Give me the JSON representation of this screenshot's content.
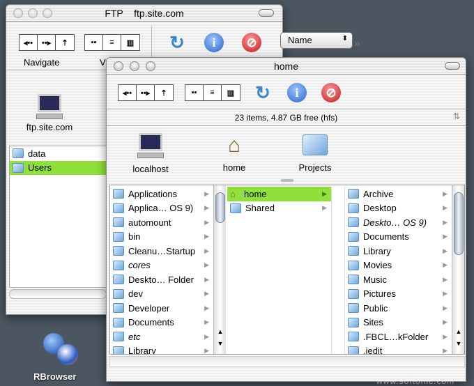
{
  "back_window": {
    "title": "FTP    ftp.site.com",
    "toolbar": {
      "navigate_label": "Navigate",
      "view_label": "V",
      "sort_popup": "Name",
      "overflow": "»",
      "nav": [
        "◂••",
        "••▸",
        "⇡"
      ],
      "view": [
        "▪▪",
        "≡",
        "▥"
      ]
    },
    "shelf": {
      "item": "ftp.site.com"
    },
    "list": [
      {
        "name": "data",
        "selected": false
      },
      {
        "name": "Users",
        "selected": true
      }
    ]
  },
  "front_window": {
    "title": "home",
    "status": "23 items, 4.87 GB free (hfs)",
    "shelf": [
      {
        "name": "localhost",
        "icon": "computer-icon"
      },
      {
        "name": "home",
        "icon": "home-icon"
      },
      {
        "name": "Projects",
        "icon": "folder-icon"
      }
    ],
    "columns": [
      [
        {
          "name": "Applications"
        },
        {
          "name": "Applica… OS 9)"
        },
        {
          "name": "automount"
        },
        {
          "name": "bin"
        },
        {
          "name": "Cleanu…Startup"
        },
        {
          "name": "cores",
          "italic": true
        },
        {
          "name": "Deskto… Folder"
        },
        {
          "name": "dev"
        },
        {
          "name": "Developer"
        },
        {
          "name": "Documents"
        },
        {
          "name": "etc",
          "italic": true
        },
        {
          "name": "Library"
        }
      ],
      [
        {
          "name": "home",
          "selected": true,
          "home": true
        },
        {
          "name": "Shared"
        }
      ],
      [
        {
          "name": "Archive"
        },
        {
          "name": "Desktop"
        },
        {
          "name": "Deskto… OS 9)",
          "italic": true
        },
        {
          "name": "Documents"
        },
        {
          "name": "Library"
        },
        {
          "name": "Movies"
        },
        {
          "name": "Music"
        },
        {
          "name": "Pictures"
        },
        {
          "name": "Public"
        },
        {
          "name": "Sites"
        },
        {
          "name": ".FBCL…kFolder"
        },
        {
          "name": ".jedit"
        }
      ]
    ]
  },
  "dock": {
    "app": "RBrowser"
  },
  "watermark": "www.softonic.com",
  "colors": {
    "selection": "#8fe03a",
    "desktop": "#4b5661"
  }
}
